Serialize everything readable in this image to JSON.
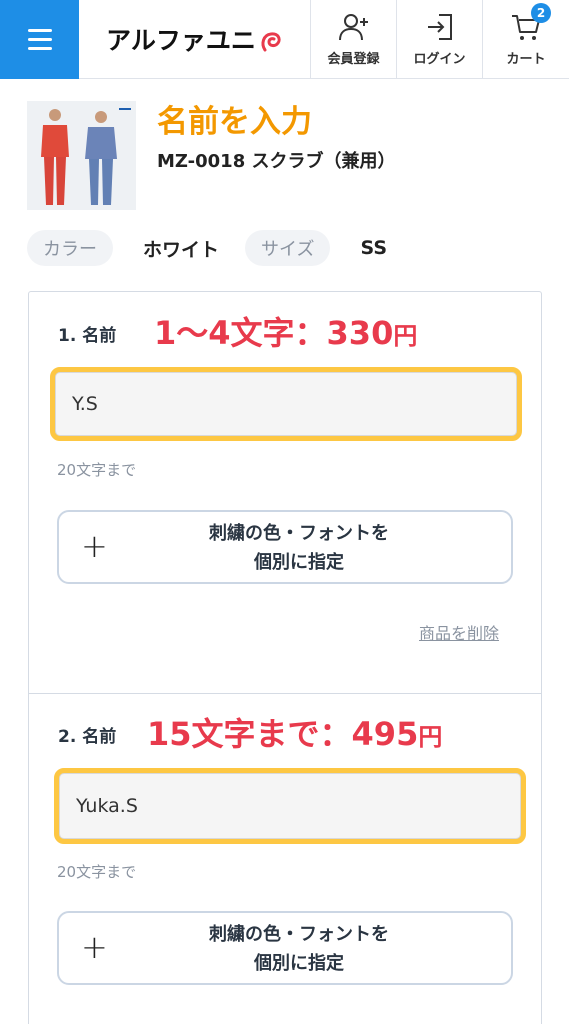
{
  "header": {
    "logo": "アルファユニ",
    "register_label": "会員登録",
    "login_label": "ログイン",
    "cart_label": "カート",
    "cart_count": "2",
    "accent_color": "#1e8ee6"
  },
  "product": {
    "heading": "名前を入力",
    "name": "MZ-0018 スクラブ（兼用）",
    "color_label": "カラー",
    "color_value": "ホワイト",
    "size_label": "サイズ",
    "size_value": "SS"
  },
  "entries": [
    {
      "label": "1. 名前",
      "price_note": "1〜4文字：330",
      "price_unit": "円",
      "value": "Y.S",
      "hint": "20文字まで",
      "embroider_line1": "刺繍の色・フォントを",
      "embroider_line2": "個別に指定",
      "delete_label": "商品を削除"
    },
    {
      "label": "2. 名前",
      "price_note": "15文字まで：495",
      "price_unit": "円",
      "value": "Yuka.S",
      "hint": "20文字まで",
      "embroider_line1": "刺繍の色・フォントを",
      "embroider_line2": "個別に指定"
    }
  ],
  "icons": {
    "menu": "hamburger-icon",
    "register": "add-user-icon",
    "login": "login-icon",
    "cart": "cart-icon",
    "plus": "plus-icon"
  }
}
